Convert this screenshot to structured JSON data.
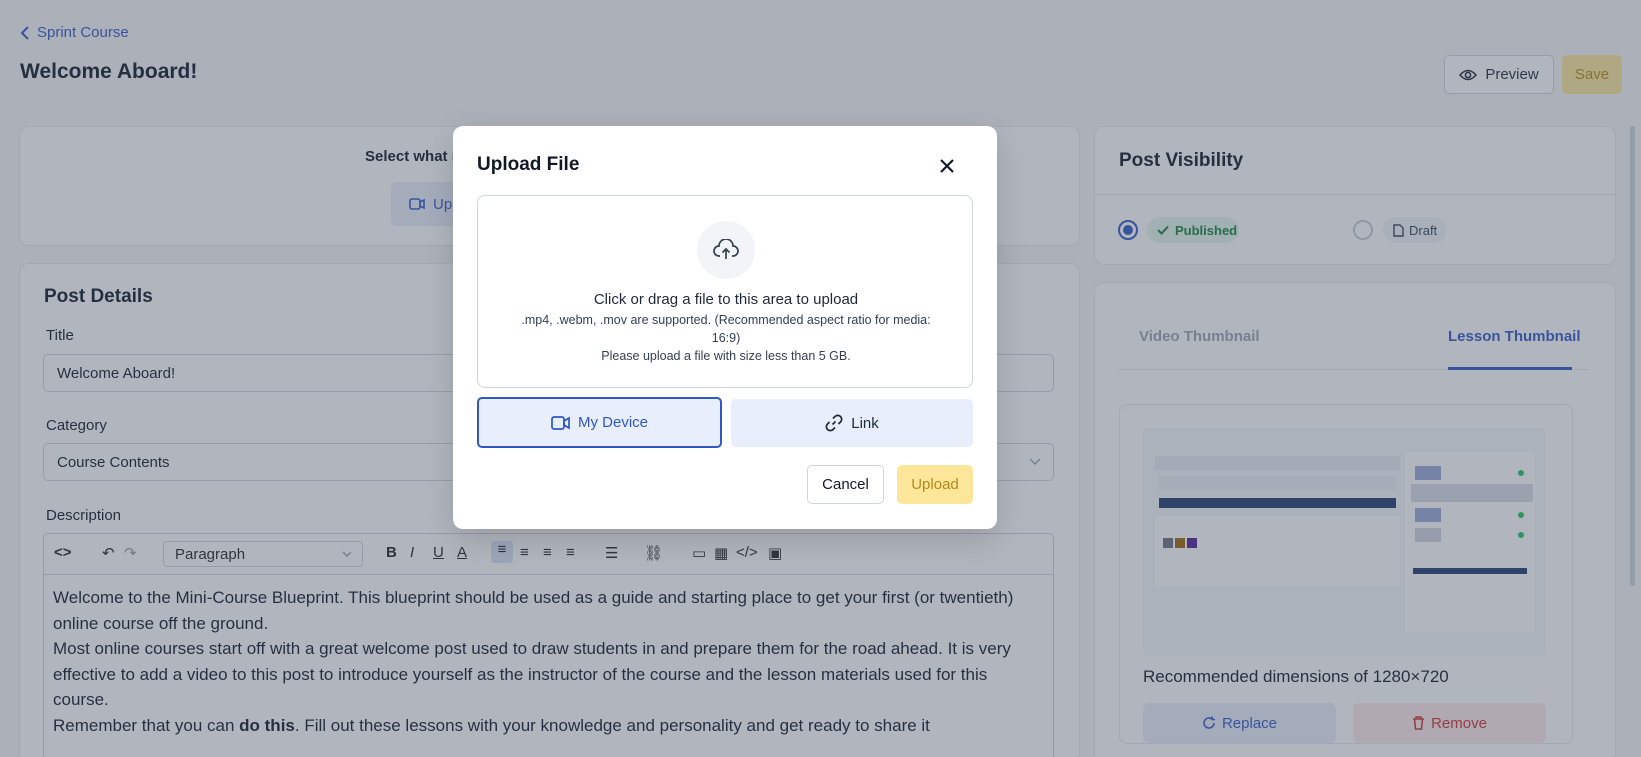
{
  "header": {
    "back_label": "Sprint Course",
    "page_title": "Welcome Aboard!",
    "preview_label": "Preview",
    "save_label": "Save"
  },
  "top_section": {
    "select_text": "Select what r",
    "upload_label": "Up"
  },
  "post_details": {
    "heading": "Post Details",
    "title_label": "Title",
    "title_value": "Welcome Aboard!",
    "category_label": "Category",
    "category_value": "Course Contents",
    "description_label": "Description",
    "paragraph_style": "Paragraph",
    "description_p1": "Welcome to the Mini-Course Blueprint. This blueprint should be used as a guide and starting place to get your first (or twentieth) online course off the ground.",
    "description_p2": "Most online courses start off with a great welcome post used to draw students in and prepare them for the road ahead. It is very effective to add a video to this post to introduce yourself as the instructor of the course and the lesson materials used for this course.",
    "description_p3_before": "Remember that you can ",
    "description_p3_bold": "do this",
    "description_p3_after": ". Fill out these lessons with your knowledge and personality and get ready to share it"
  },
  "visibility": {
    "heading": "Post Visibility",
    "published_label": "Published",
    "draft_label": "Draft",
    "selected": "Published"
  },
  "thumbnails": {
    "tab_video": "Video Thumbnail",
    "tab_lesson": "Lesson Thumbnail",
    "active_tab": "Lesson Thumbnail",
    "recommended": "Recommended dimensions of 1280×720",
    "replace_label": "Replace",
    "remove_label": "Remove"
  },
  "modal": {
    "title": "Upload File",
    "drop_main": "Click or drag a file to this area to upload",
    "drop_formats": ".mp4, .webm, .mov are supported. (Recommended aspect ratio for media: 16:9)",
    "drop_size": "Please upload a file with size less than 5 GB.",
    "my_device_label": "My Device",
    "link_label": "Link",
    "cancel_label": "Cancel",
    "upload_label": "Upload"
  },
  "colors": {
    "accent": "#2f57c7",
    "success": "#17803d",
    "danger": "#d12d2d",
    "primary_disabled": "#fde69a"
  },
  "icons": [
    "chevron-left-icon",
    "eye-icon",
    "video-icon",
    "upload-cloud-icon",
    "close-icon",
    "link-icon",
    "refresh-icon",
    "trash-icon",
    "check-icon",
    "file-icon"
  ]
}
